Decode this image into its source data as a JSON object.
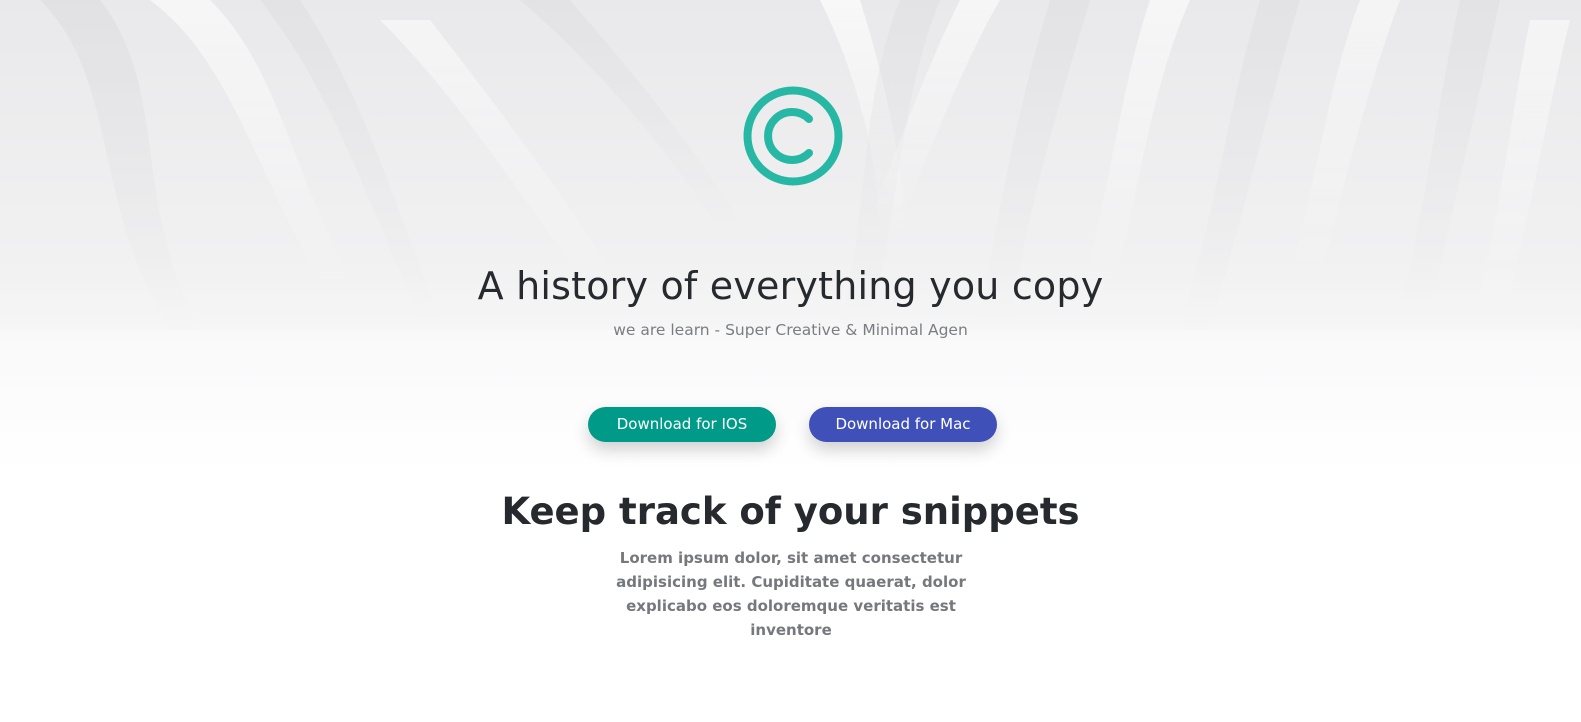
{
  "hero": {
    "logo_icon": "copyright-c-icon",
    "accent_color": "#27b8a5",
    "headline": "A history of everything you copy",
    "subheadline": "we are learn - Super Creative & Minimal Agen"
  },
  "actions": {
    "ios_label": "Download for IOS",
    "ios_color": "#009b88",
    "mac_label": "Download for Mac",
    "mac_color": "#3f51b8"
  },
  "features": {
    "title": "Keep track of your snippets",
    "description": "Lorem ipsum dolor, sit amet consectetur adipisicing elit. Cupiditate quaerat, dolor explicabo eos doloremque veritatis est inventore"
  }
}
